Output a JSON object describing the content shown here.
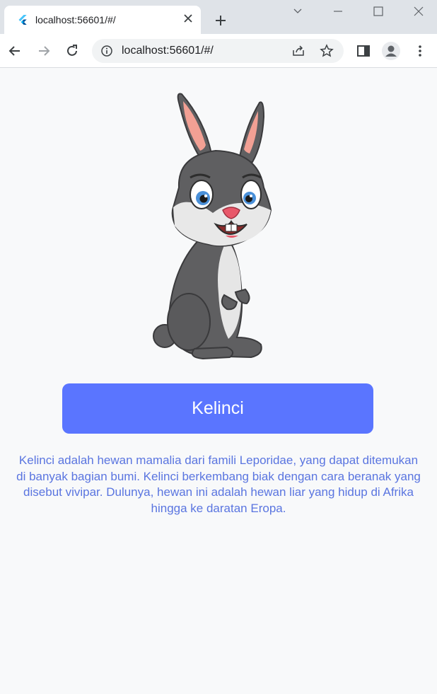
{
  "browser": {
    "tab_title": "localhost:56601/#/",
    "url": "localhost:56601/#/",
    "accent_color": "#5a75ff"
  },
  "icons": {
    "favicon": "flutter-icon",
    "back": "arrow-left-icon",
    "forward": "arrow-right-icon",
    "reload": "reload-icon",
    "info": "info-icon",
    "share": "share-icon",
    "bookmark": "star-icon",
    "side_panel": "side-panel-icon",
    "profile": "profile-icon",
    "menu": "kebab-menu-icon"
  },
  "page": {
    "animal_button_label": "Kelinci",
    "description": "Kelinci adalah hewan mamalia dari famili Leporidae, yang dapat ditemukan di banyak bagian bumi. Kelinci berkembang biak dengan cara beranak yang disebut vivipar. Dulunya, hewan ini adalah hewan liar yang hidup di Afrika hingga ke daratan Eropa."
  }
}
